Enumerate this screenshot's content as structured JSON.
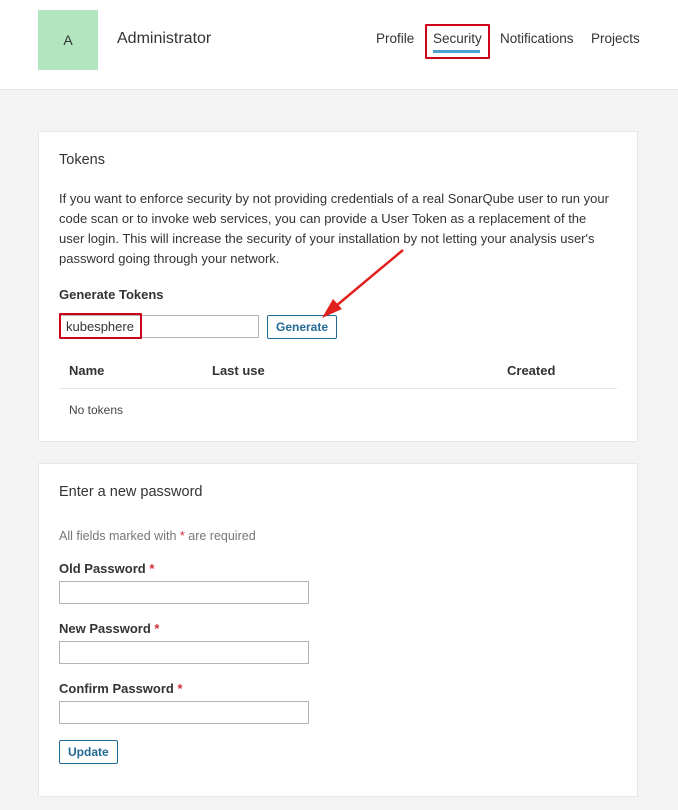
{
  "header": {
    "avatar_letter": "A",
    "user_name": "Administrator",
    "nav": {
      "profile": "Profile",
      "security": "Security",
      "notifications": "Notifications",
      "projects": "Projects"
    },
    "active_tab": "Security",
    "accent_color": "#4b9fd5"
  },
  "tokens": {
    "title": "Tokens",
    "description": "If you want to enforce security by not providing credentials of a real SonarQube user to run your code scan or to invoke web services, you can provide a User Token as a replacement of the user login. This will increase the security of your installation by not letting your analysis user's password going through your network.",
    "generate_title": "Generate Tokens",
    "token_name_value": "kubesphere",
    "generate_label": "Generate",
    "columns": [
      "Name",
      "Last use",
      "Created"
    ],
    "empty_text": "No tokens"
  },
  "password": {
    "title": "Enter a new password",
    "required_note_prefix": "All fields marked with",
    "required_star": "*",
    "required_note_suffix": "are required",
    "old_label": "Old Password",
    "new_label": "New Password",
    "confirm_label": "Confirm Password",
    "update_label": "Update"
  },
  "annotation_color": "#d0021b"
}
